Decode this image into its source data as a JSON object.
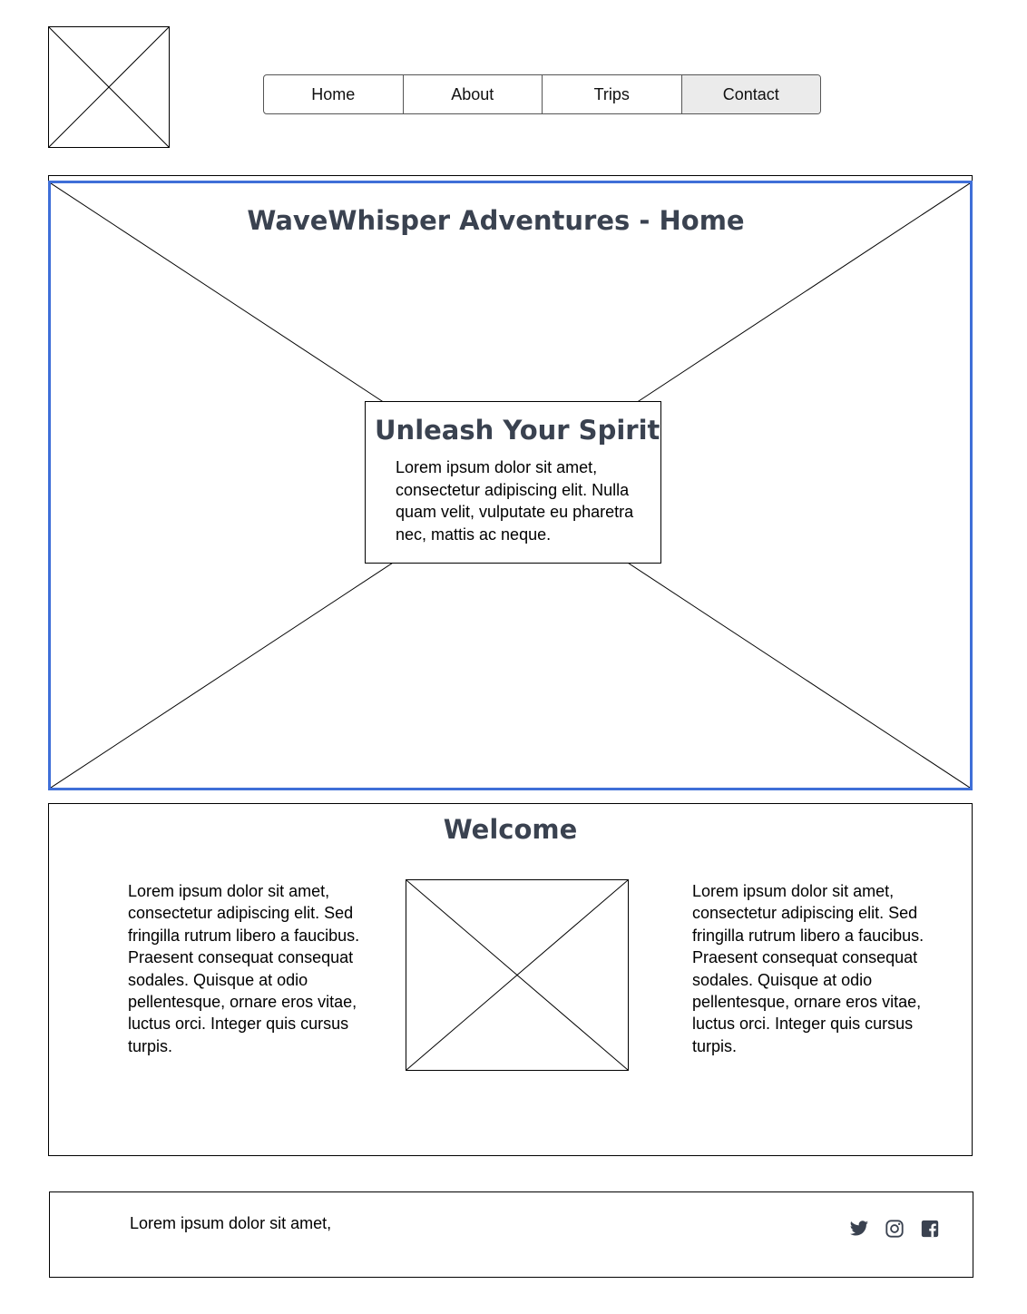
{
  "nav": {
    "items": [
      {
        "label": "Home"
      },
      {
        "label": "About"
      },
      {
        "label": "Trips"
      },
      {
        "label": "Contact"
      }
    ],
    "active": "Contact"
  },
  "hero": {
    "title": "WaveWhisper Adventures - Home",
    "card": {
      "title": "Unleash Your Spirit",
      "text": "Lorem ipsum dolor sit amet, consectetur adipiscing elit. Nulla quam velit, vulputate eu pharetra nec, mattis ac neque."
    },
    "selection_color": "#3f6fd8"
  },
  "welcome": {
    "title": "Welcome",
    "left_text": "Lorem ipsum dolor sit amet, consectetur adipiscing elit. Sed fringilla rutrum libero a faucibus. Praesent consequat consequat sodales. Quisque at odio pellentesque, ornare eros vitae, luctus orci. Integer quis cursus turpis.",
    "right_text": "Lorem ipsum dolor sit amet, consectetur adipiscing elit. Sed fringilla rutrum libero a faucibus. Praesent consequat consequat sodales. Quisque at odio pellentesque, ornare eros vitae, luctus orci. Integer quis cursus turpis."
  },
  "footer": {
    "text": "Lorem ipsum dolor sit amet,",
    "social_icons": [
      "twitter-icon",
      "instagram-icon",
      "facebook-icon"
    ]
  },
  "colors": {
    "heading": "#3a4250",
    "nav_active_bg": "#ebebeb"
  }
}
